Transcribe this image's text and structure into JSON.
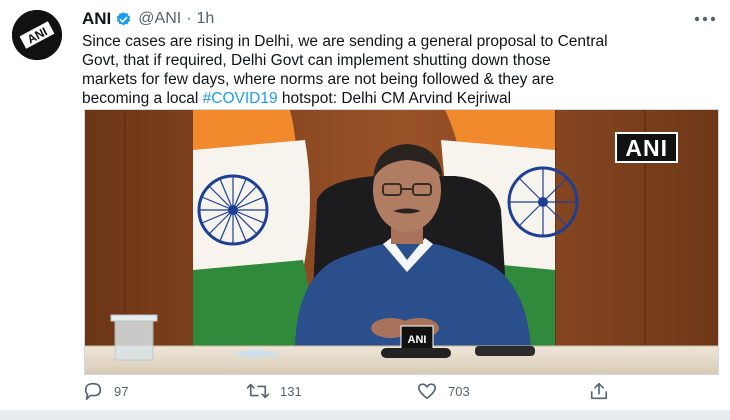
{
  "tweet": {
    "account_name": "ANI",
    "handle": "@ANI",
    "separator": "·",
    "time": "1h",
    "text_main": "Since cases are rising in Delhi, we are sending a general proposal to Central\nGovt, that if required, Delhi Govt can implement shutting down those\nmarkets for few days, where norms are not being followed & they are\nbecoming a local ",
    "hashtag": "#COVID19",
    "text_tail": " hotspot: Delhi CM Arvind Kejriwal"
  },
  "avatar": {
    "logo_text": "ANI"
  },
  "media": {
    "watermark": "ANI",
    "mic_label": "ANI"
  },
  "actions": {
    "replies": "97",
    "retweets": "131",
    "likes": "703"
  },
  "colors": {
    "accent": "#1d9bf0",
    "secondary_text": "#536471",
    "primary_text": "#0f1419"
  },
  "icons": [
    "verified-badge-icon",
    "more-options-icon",
    "reply-icon",
    "retweet-icon",
    "like-icon",
    "share-icon"
  ]
}
